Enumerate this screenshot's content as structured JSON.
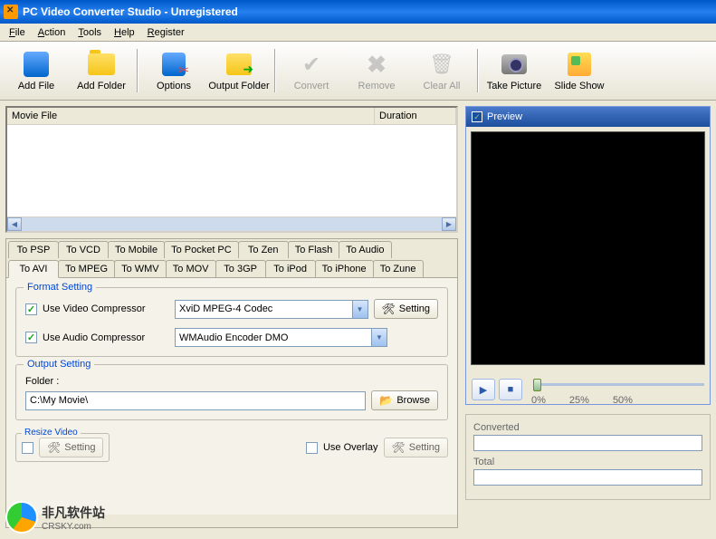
{
  "window": {
    "title": "PC Video Converter Studio - Unregistered"
  },
  "menu": {
    "items": [
      "File",
      "Action",
      "Tools",
      "Help",
      "Register"
    ]
  },
  "toolbar": {
    "add_file": "Add File",
    "add_folder": "Add Folder",
    "options": "Options",
    "output_folder": "Output Folder",
    "convert": "Convert",
    "remove": "Remove",
    "clear_all": "Clear All",
    "take_picture": "Take Picture",
    "slide_show": "Slide Show"
  },
  "file_list": {
    "col_movie": "Movie File",
    "col_duration": "Duration"
  },
  "tabs_row1": [
    "To PSP",
    "To VCD",
    "To Mobile",
    "To Pocket PC",
    "To Zen",
    "To Flash",
    "To Audio"
  ],
  "tabs_row2": [
    "To AVI",
    "To MPEG",
    "To WMV",
    "To MOV",
    "To 3GP",
    "To iPod",
    "To iPhone",
    "To Zune"
  ],
  "active_tab": "To AVI",
  "format_setting": {
    "legend": "Format Setting",
    "use_video_label": "Use Video Compressor",
    "video_codec": "XviD MPEG-4 Codec",
    "use_audio_label": "Use Audio Compressor",
    "audio_codec": "WMAudio Encoder DMO",
    "setting_btn": "Setting"
  },
  "output_setting": {
    "legend": "Output Setting",
    "folder_label": "Folder :",
    "folder_value": "C:\\My Movie\\",
    "browse_btn": "Browse"
  },
  "resize": {
    "legend": "Resize Video",
    "setting_btn": "Setting"
  },
  "overlay": {
    "label": "Use Overlay",
    "setting_btn": "Setting"
  },
  "preview": {
    "label": "Preview",
    "slider_labels": [
      "0%",
      "25%",
      "50%"
    ]
  },
  "progress": {
    "converted_label": "Converted",
    "total_label": "Total"
  },
  "watermark": {
    "text": "非凡软件站",
    "sub": "CRSKY.com"
  }
}
